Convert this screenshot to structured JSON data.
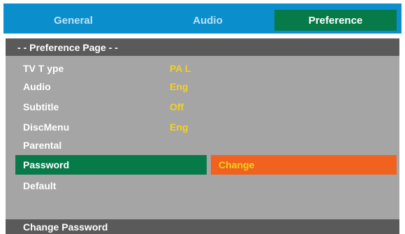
{
  "tabs": [
    {
      "label": "General",
      "active": false
    },
    {
      "label": "Audio",
      "active": false
    },
    {
      "label": "Preference",
      "active": true
    }
  ],
  "page_title": "- -  Preference Page - -",
  "settings": [
    {
      "label": "TV T  ype",
      "value": "PA L"
    },
    {
      "label": "Audio",
      "value": "Eng"
    },
    {
      "label": "Subtitle",
      "value": "Off"
    },
    {
      "label": "DiscMenu",
      "value": "Eng"
    },
    {
      "label": "Parental",
      "value": ""
    },
    {
      "label": "Password",
      "value": "Change",
      "selected": true
    },
    {
      "label": "Default",
      "value": ""
    }
  ],
  "footer": {
    "hint": "Change Password"
  },
  "colors": {
    "tabbar": "#0a8fcc",
    "active_tab": "#077a4a",
    "panel": "#a5a5a5",
    "header_bar": "#5a5a5a",
    "value_text": "#f2d21e",
    "selected_value_box": "#f0621e"
  }
}
